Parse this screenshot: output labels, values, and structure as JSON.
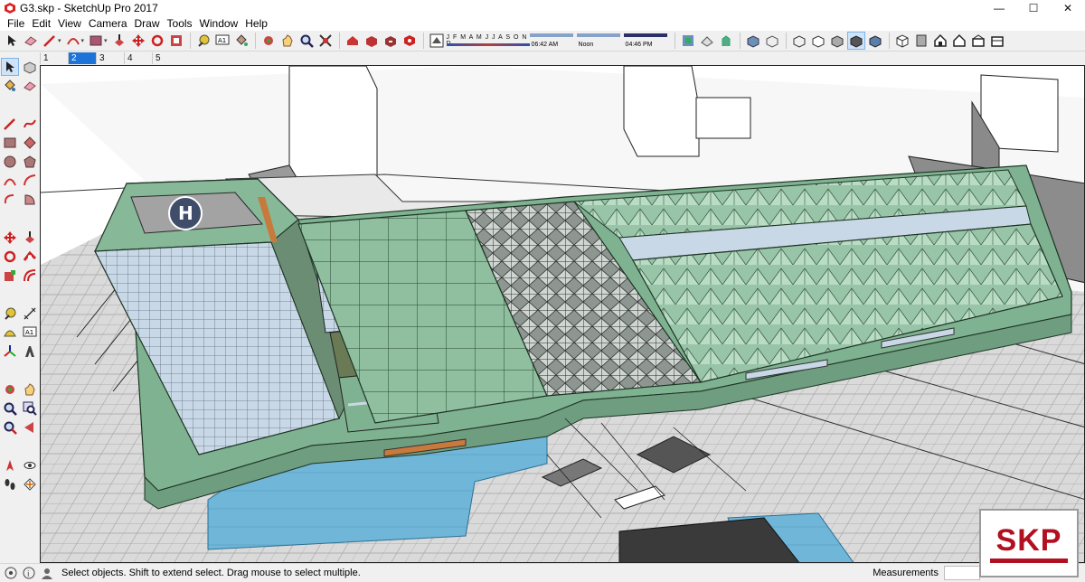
{
  "window": {
    "title": "G3.skp - SketchUp Pro 2017",
    "minimize": "—",
    "maximize": "☐",
    "close": "✕"
  },
  "menu": {
    "items": [
      "File",
      "Edit",
      "View",
      "Camera",
      "Draw",
      "Tools",
      "Window",
      "Help"
    ]
  },
  "shadow": {
    "months": "J F M A M J J A S O N D",
    "time_left": "06:42 AM",
    "time_mid": "Noon",
    "time_right": "04:46 PM"
  },
  "scenes": {
    "tabs": [
      "1",
      "2",
      "3",
      "4",
      "5"
    ],
    "active": "2"
  },
  "status": {
    "message": "Select objects. Shift to extend select. Drag mouse to select multiple.",
    "measurements_label": "Measurements"
  },
  "badge": {
    "text": "SKP"
  },
  "colors": {
    "roof_green": "#8fbf9e",
    "water": "#6fb6d8",
    "glass": "#c9d8e6",
    "accent_red": "#b01020",
    "tab_blue": "#1e73d8"
  }
}
